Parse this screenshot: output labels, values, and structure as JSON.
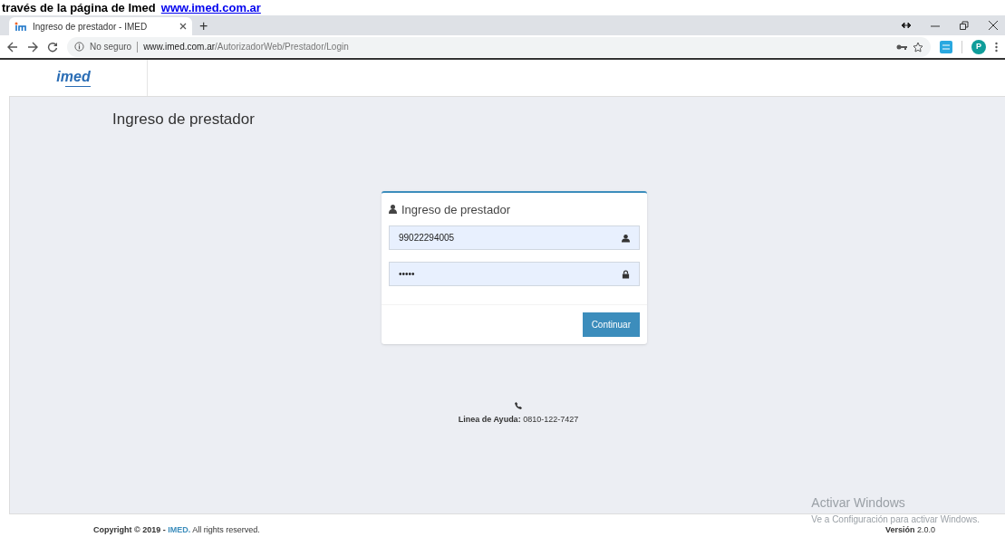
{
  "document_strip": {
    "text": "través de la página de Imed",
    "link": "www.imed.com.ar"
  },
  "browser": {
    "tabs": [
      {
        "title": "Ingreso de prestador - IMED",
        "selected": true
      }
    ],
    "new_tab": "+",
    "security": "No seguro",
    "url_host": "www.imed.com.ar",
    "url_path": "/AutorizadorWeb/Prestador/Login",
    "profile_initial": "P"
  },
  "header": {
    "logo": "imed"
  },
  "page_title": "Ingreso de prestador",
  "login_panel": {
    "title": "Ingreso de prestador",
    "fields": [
      {
        "kind": "user",
        "value": "99022294005"
      },
      {
        "kind": "password",
        "value": "•••••"
      }
    ],
    "submit": "Continuar"
  },
  "help": {
    "label": "Linea de Ayuda:",
    "phone": "0810-122-7427"
  },
  "footer": {
    "copyright": "Copyright © 2019 - ",
    "brand": "IMED.",
    "rights": " All rights reserved.",
    "version_label": "Versión",
    "version": "2.0.0"
  },
  "windows_notice": {
    "title": "Activar Windows",
    "subtitle": "Ve a Configuración para activar Windows."
  }
}
